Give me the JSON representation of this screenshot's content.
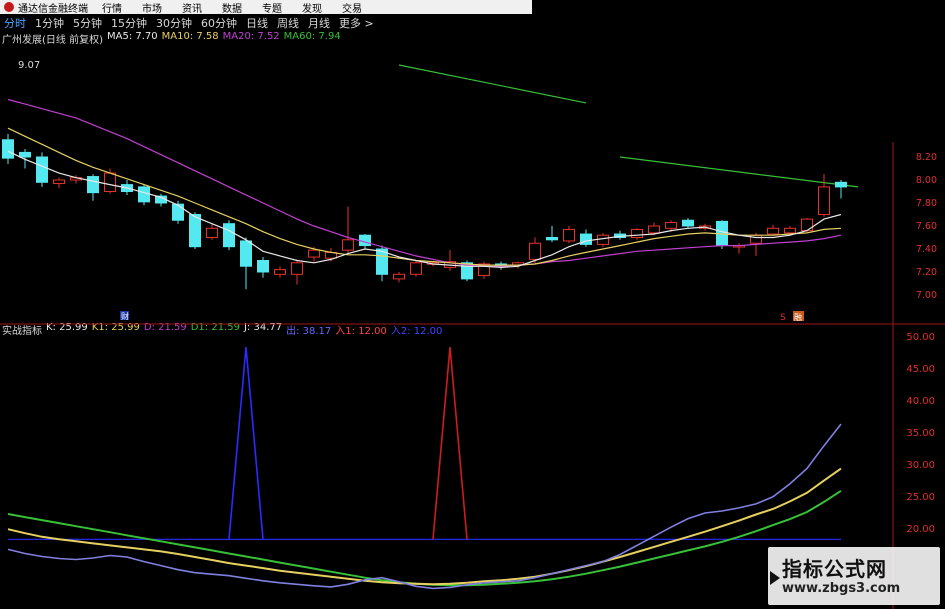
{
  "menubar": {
    "title": "通达信金融终端",
    "items": [
      "行情",
      "市场",
      "资讯",
      "数据",
      "专题",
      "发现",
      "交易"
    ]
  },
  "periods": [
    "分时",
    "1分钟",
    "5分钟",
    "15分钟",
    "30分钟",
    "60分钟",
    "日线",
    "周线",
    "月线",
    "更多 >"
  ],
  "main_legend": {
    "stock": "广州发展(日线 前复权)",
    "ma5": "MA5: 7.70",
    "ma10": "MA10: 7.58",
    "ma20": "MA20: 7.52",
    "ma60": "MA60: 7.94",
    "high_label": "9.07",
    "marker_cai": "财",
    "marker_s": "S",
    "marker_qu": "融"
  },
  "sub_legend": {
    "name": "实战指标",
    "k": "K: 25.99",
    "k1": "K1: 25.99",
    "d": "D: 21.59",
    "d1": "D1: 21.59",
    "j": "J: 34.77",
    "h": "出: 38.17",
    "buy": "入1: 12.00",
    "buy2": "入2: 12.00"
  },
  "price_axis": [
    "8.20",
    "8.00",
    "7.80",
    "7.60",
    "7.40",
    "7.20",
    "7.00"
  ],
  "indicator_axis": [
    "50.00",
    "45.00",
    "40.00",
    "35.00",
    "30.00",
    "25.00",
    "20.00"
  ],
  "colors": {
    "up": "#e8302c",
    "down": "#54e8f0",
    "ma5": "#e8e8e8",
    "ma10": "#e6d060",
    "ma20": "#c040d0",
    "ma60": "#38c038",
    "axis": "#e03030"
  },
  "watermark": {
    "line1": "指标公式网",
    "line2": "www.zbgs3.com"
  },
  "chart_data": {
    "type": "candlestick",
    "price_ylim": [
      7.0,
      8.2
    ],
    "candles": [
      {
        "o": 8.35,
        "c": 8.19,
        "h": 8.4,
        "l": 8.14
      },
      {
        "o": 8.24,
        "c": 8.2,
        "h": 8.27,
        "l": 8.1
      },
      {
        "o": 8.2,
        "c": 7.98,
        "h": 8.24,
        "l": 7.94
      },
      {
        "o": 7.97,
        "c": 8.0,
        "h": 8.02,
        "l": 7.93
      },
      {
        "o": 8.0,
        "c": 8.02,
        "h": 8.04,
        "l": 7.97
      },
      {
        "o": 8.03,
        "c": 7.89,
        "h": 8.05,
        "l": 7.82
      },
      {
        "o": 7.9,
        "c": 8.06,
        "h": 8.1,
        "l": 7.88
      },
      {
        "o": 7.96,
        "c": 7.9,
        "h": 8.0,
        "l": 7.87
      },
      {
        "o": 7.94,
        "c": 7.81,
        "h": 7.96,
        "l": 7.78
      },
      {
        "o": 7.86,
        "c": 7.8,
        "h": 7.88,
        "l": 7.77
      },
      {
        "o": 7.79,
        "c": 7.65,
        "h": 7.82,
        "l": 7.62
      },
      {
        "o": 7.7,
        "c": 7.42,
        "h": 7.72,
        "l": 7.4
      },
      {
        "o": 7.5,
        "c": 7.58,
        "h": 7.62,
        "l": 7.48
      },
      {
        "o": 7.62,
        "c": 7.42,
        "h": 7.65,
        "l": 7.39
      },
      {
        "o": 7.47,
        "c": 7.25,
        "h": 7.5,
        "l": 7.05
      },
      {
        "o": 7.3,
        "c": 7.2,
        "h": 7.33,
        "l": 7.15
      },
      {
        "o": 7.18,
        "c": 7.22,
        "h": 7.25,
        "l": 7.15
      },
      {
        "o": 7.18,
        "c": 7.28,
        "h": 7.31,
        "l": 7.09
      },
      {
        "o": 7.33,
        "c": 7.39,
        "h": 7.42,
        "l": 7.29
      },
      {
        "o": 7.32,
        "c": 7.37,
        "h": 7.41,
        "l": 7.29
      },
      {
        "o": 7.39,
        "c": 7.48,
        "h": 7.77,
        "l": 7.36
      },
      {
        "o": 7.52,
        "c": 7.43,
        "h": 7.53,
        "l": 7.4
      },
      {
        "o": 7.4,
        "c": 7.18,
        "h": 7.43,
        "l": 7.12
      },
      {
        "o": 7.14,
        "c": 7.18,
        "h": 7.2,
        "l": 7.11
      },
      {
        "o": 7.18,
        "c": 7.28,
        "h": 7.3,
        "l": 7.16
      },
      {
        "o": 7.27,
        "c": 7.28,
        "h": 7.29,
        "l": 7.25
      },
      {
        "o": 7.24,
        "c": 7.29,
        "h": 7.39,
        "l": 7.21
      },
      {
        "o": 7.28,
        "c": 7.14,
        "h": 7.3,
        "l": 7.12
      },
      {
        "o": 7.17,
        "c": 7.27,
        "h": 7.29,
        "l": 7.14
      },
      {
        "o": 7.27,
        "c": 7.25,
        "h": 7.29,
        "l": 7.22
      },
      {
        "o": 7.26,
        "c": 7.28,
        "h": 7.29,
        "l": 7.23
      },
      {
        "o": 7.31,
        "c": 7.45,
        "h": 7.5,
        "l": 7.27
      },
      {
        "o": 7.5,
        "c": 7.48,
        "h": 7.6,
        "l": 7.46
      },
      {
        "o": 7.47,
        "c": 7.57,
        "h": 7.6,
        "l": 7.45
      },
      {
        "o": 7.53,
        "c": 7.44,
        "h": 7.57,
        "l": 7.42
      },
      {
        "o": 7.44,
        "c": 7.52,
        "h": 7.54,
        "l": 7.42
      },
      {
        "o": 7.53,
        "c": 7.5,
        "h": 7.56,
        "l": 7.48
      },
      {
        "o": 7.5,
        "c": 7.57,
        "h": 7.58,
        "l": 7.48
      },
      {
        "o": 7.54,
        "c": 7.6,
        "h": 7.63,
        "l": 7.52
      },
      {
        "o": 7.58,
        "c": 7.63,
        "h": 7.65,
        "l": 7.55
      },
      {
        "o": 7.65,
        "c": 7.6,
        "h": 7.67,
        "l": 7.58
      },
      {
        "o": 7.58,
        "c": 7.6,
        "h": 7.62,
        "l": 7.56
      },
      {
        "o": 7.64,
        "c": 7.43,
        "h": 7.65,
        "l": 7.4
      },
      {
        "o": 7.42,
        "c": 7.43,
        "h": 7.45,
        "l": 7.36
      },
      {
        "o": 7.45,
        "c": 7.52,
        "h": 7.54,
        "l": 7.34
      },
      {
        "o": 7.53,
        "c": 7.58,
        "h": 7.61,
        "l": 7.52
      },
      {
        "o": 7.54,
        "c": 7.58,
        "h": 7.6,
        "l": 7.52
      },
      {
        "o": 7.56,
        "c": 7.66,
        "h": 7.67,
        "l": 7.55
      },
      {
        "o": 7.7,
        "c": 7.94,
        "h": 8.05,
        "l": 7.68
      },
      {
        "o": 7.98,
        "c": 7.94,
        "h": 8.0,
        "l": 7.84
      }
    ],
    "ma5": [
      8.25,
      8.18,
      8.12,
      8.06,
      8.02,
      7.99,
      7.96,
      7.93,
      7.89,
      7.85,
      7.78,
      7.68,
      7.62,
      7.56,
      7.48,
      7.38,
      7.34,
      7.3,
      7.28,
      7.31,
      7.36,
      7.4,
      7.38,
      7.33,
      7.3,
      7.27,
      7.26,
      7.25,
      7.25,
      7.24,
      7.25,
      7.3,
      7.35,
      7.42,
      7.47,
      7.49,
      7.51,
      7.52,
      7.53,
      7.56,
      7.58,
      7.59,
      7.55,
      7.52,
      7.5,
      7.5,
      7.52,
      7.56,
      7.66,
      7.7
    ],
    "ma10": [
      8.45,
      8.38,
      8.31,
      8.24,
      8.17,
      8.11,
      8.06,
      8.01,
      7.96,
      7.91,
      7.86,
      7.8,
      7.74,
      7.68,
      7.62,
      7.55,
      7.49,
      7.44,
      7.4,
      7.37,
      7.35,
      7.35,
      7.34,
      7.32,
      7.3,
      7.29,
      7.28,
      7.27,
      7.26,
      7.26,
      7.26,
      7.27,
      7.3,
      7.34,
      7.37,
      7.4,
      7.43,
      7.46,
      7.49,
      7.51,
      7.53,
      7.54,
      7.53,
      7.52,
      7.52,
      7.52,
      7.53,
      7.54,
      7.57,
      7.58
    ],
    "ma20": [
      8.7,
      8.66,
      8.62,
      8.58,
      8.54,
      8.48,
      8.42,
      8.36,
      8.29,
      8.22,
      8.15,
      8.08,
      8.01,
      7.94,
      7.87,
      7.8,
      7.73,
      7.66,
      7.6,
      7.55,
      7.5,
      7.46,
      7.42,
      7.38,
      7.34,
      7.31,
      7.28,
      7.26,
      7.25,
      7.25,
      7.26,
      7.27,
      7.29,
      7.3,
      7.32,
      7.34,
      7.36,
      7.38,
      7.39,
      7.4,
      7.41,
      7.42,
      7.43,
      7.43,
      7.44,
      7.45,
      7.46,
      7.47,
      7.49,
      7.52
    ],
    "ma60_segments": [
      {
        "from": 23,
        "to": 34,
        "v0": 9.0,
        "v1": 8.67
      },
      {
        "from": 36,
        "to": 50,
        "v0": 8.2,
        "v1": 7.94
      }
    ],
    "k": [
      14.0,
      13.2,
      12.5,
      12.0,
      11.6,
      11.2,
      10.8,
      10.4,
      10.0,
      9.6,
      9.1,
      8.5,
      7.9,
      7.3,
      6.8,
      6.3,
      5.8,
      5.4,
      5.0,
      4.6,
      4.2,
      3.8,
      3.5,
      3.3,
      3.2,
      3.1,
      3.2,
      3.4,
      3.7,
      3.9,
      4.2,
      4.6,
      5.2,
      5.9,
      6.7,
      7.6,
      8.5,
      9.5,
      10.5,
      11.5,
      12.5,
      13.5,
      14.6,
      15.7,
      16.9,
      18.0,
      19.5,
      21.2,
      23.6,
      25.99
    ],
    "d": [
      17.0,
      16.4,
      15.8,
      15.2,
      14.6,
      14.0,
      13.4,
      12.8,
      12.2,
      11.6,
      11.0,
      10.4,
      9.8,
      9.2,
      8.6,
      8.0,
      7.4,
      6.8,
      6.2,
      5.6,
      5.0,
      4.4,
      3.9,
      3.5,
      3.2,
      3.0,
      2.9,
      2.9,
      3.0,
      3.2,
      3.4,
      3.7,
      4.1,
      4.6,
      5.2,
      5.9,
      6.6,
      7.4,
      8.2,
      9.0,
      9.8,
      10.6,
      11.5,
      12.5,
      13.6,
      14.8,
      16.0,
      17.4,
      19.4,
      21.59
    ],
    "j": [
      10.0,
      9.2,
      8.6,
      8.2,
      8.0,
      8.3,
      8.8,
      8.5,
      7.6,
      6.8,
      6.0,
      5.4,
      5.1,
      4.8,
      4.3,
      3.8,
      3.4,
      3.1,
      2.8,
      2.6,
      3.1,
      4.0,
      4.4,
      3.6,
      2.7,
      2.3,
      2.5,
      3.0,
      3.4,
      3.6,
      3.8,
      4.4,
      5.2,
      6.0,
      6.8,
      7.6,
      9.0,
      10.8,
      12.6,
      14.4,
      16.1,
      17.2,
      17.6,
      18.2,
      19.0,
      20.4,
      23.0,
      26.0,
      30.5,
      34.77
    ],
    "signal_base": 12.0,
    "spikes": [
      {
        "index": 14,
        "value": 50.0,
        "color": "#2b2bff"
      },
      {
        "index": 26,
        "value": 50.0,
        "color": "#cc1e1e"
      }
    ],
    "ind_ylim": [
      0,
      52
    ]
  }
}
